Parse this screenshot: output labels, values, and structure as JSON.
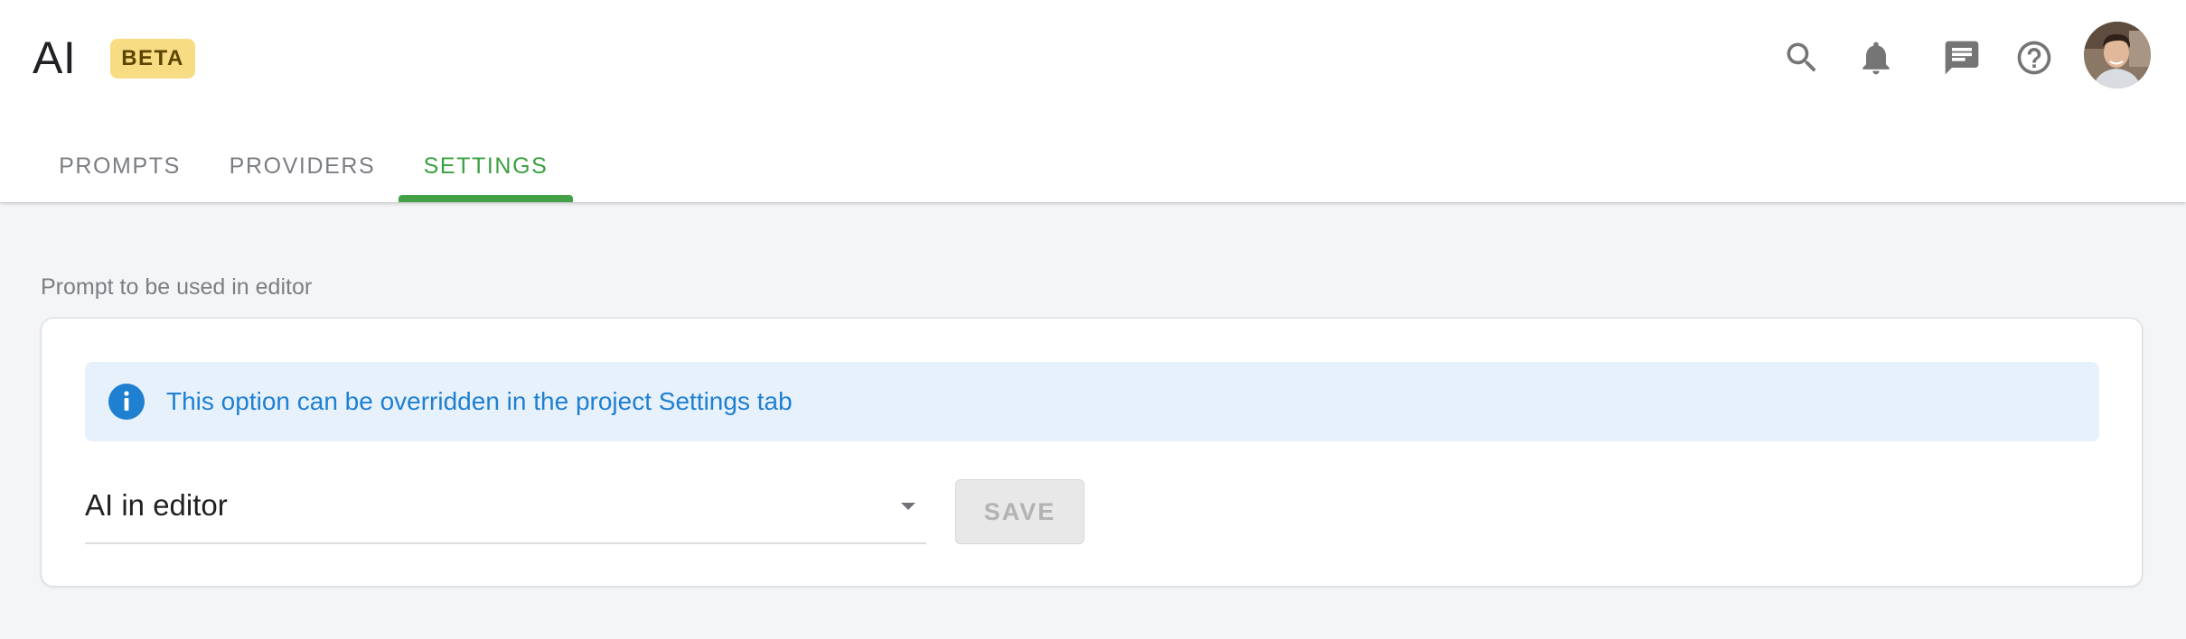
{
  "header": {
    "title": "AI",
    "badge": "BETA"
  },
  "toolbar_icons": [
    "search-icon",
    "bell-icon",
    "chat-icon",
    "help-icon"
  ],
  "tabs": [
    {
      "label": "PROMPTS",
      "active": false
    },
    {
      "label": "PROVIDERS",
      "active": false
    },
    {
      "label": "SETTINGS",
      "active": true
    }
  ],
  "settings": {
    "section_label": "Prompt to be used in editor",
    "info_message": "This option can be overridden in the project Settings tab",
    "selected_prompt": "AI in editor",
    "save_label": "SAVE"
  },
  "colors": {
    "accent_green": "#43a047",
    "info_blue": "#1f7fd0",
    "info_bg": "#e6f1fb",
    "badge_bg": "#f7dc83"
  }
}
